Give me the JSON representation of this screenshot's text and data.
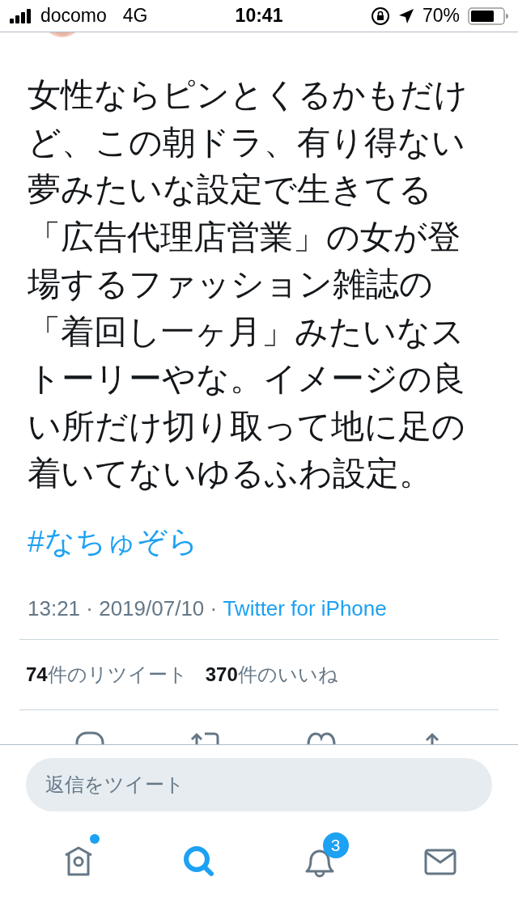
{
  "status_bar": {
    "carrier": "docomo",
    "network": "4G",
    "time": "10:41",
    "battery": "70%"
  },
  "tweet": {
    "text": "女性ならピンとくるかもだけど、この朝ドラ、有り得ない夢みたいな設定で生きてる「広告代理店営業」の女が登場するファッション雑誌の「着回し一ヶ月」みたいなストーリーやな。イメージの良い所だけ切り取って地に足の着いてないゆるふわ設定。",
    "hashtag": "#なちゅぞら",
    "time": "13:21 · 2019/07/10 · ",
    "source": "Twitter for iPhone"
  },
  "stats": [
    {
      "count": "74",
      "label": "件のリツイート"
    },
    {
      "count": "370",
      "label": "件のいいね"
    }
  ],
  "actions": [
    {
      "kind": "reply"
    },
    {
      "kind": "retweet"
    },
    {
      "kind": "like"
    },
    {
      "kind": "share"
    }
  ],
  "reply_box": {
    "placeholder": "返信をツイート"
  },
  "tab_bar": [
    {
      "kind": "home",
      "selected": false,
      "dot": true
    },
    {
      "kind": "search",
      "selected": true,
      "dot": false
    },
    {
      "kind": "notifications",
      "selected": false,
      "dot": false,
      "badge": "3"
    },
    {
      "kind": "messages",
      "selected": false,
      "dot": false
    }
  ]
}
